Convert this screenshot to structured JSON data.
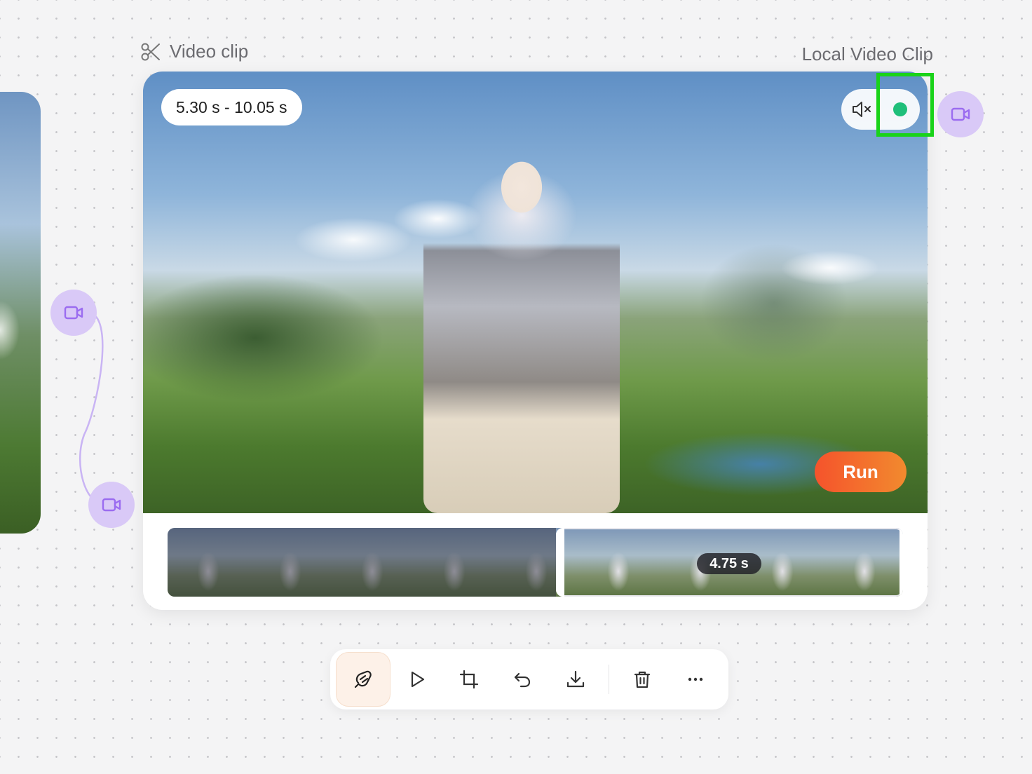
{
  "header": {
    "title": "Video clip",
    "node_type": "Local Video Clip"
  },
  "video": {
    "time_range": "5.30 s - 10.05 s",
    "run_label": "Run",
    "status_color": "#1fbf7a"
  },
  "timeline": {
    "selection_duration": "4.75 s",
    "thumbnail_count": 9,
    "selected_from_index": 5
  },
  "toolbar": {
    "items": [
      {
        "name": "magic-edit-icon",
        "active": true
      },
      {
        "name": "play-icon"
      },
      {
        "name": "crop-icon"
      },
      {
        "name": "undo-icon"
      },
      {
        "name": "download-icon"
      },
      {
        "name": "delete-icon"
      },
      {
        "name": "more-icon"
      }
    ]
  },
  "colors": {
    "accent_purple": "#9b6cf0",
    "node_bg": "#d9c9f7",
    "run_gradient_start": "#f5532c",
    "run_gradient_end": "#f28a2e",
    "highlight_box": "#19d319"
  }
}
